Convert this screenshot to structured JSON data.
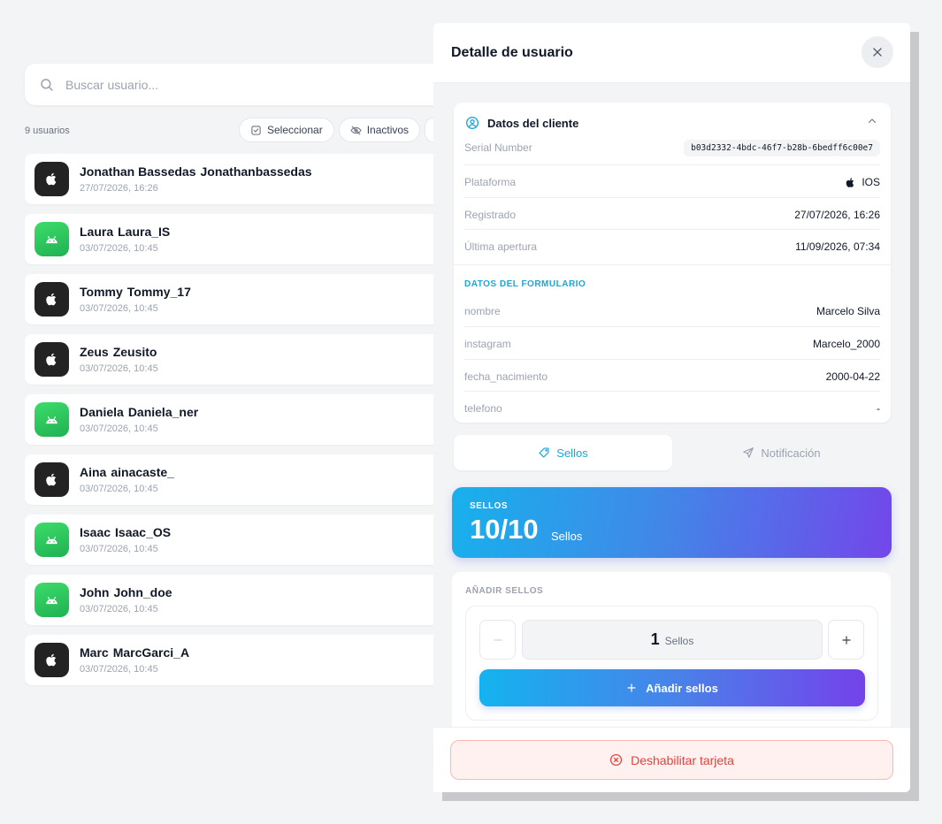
{
  "search": {
    "placeholder": "Buscar usuario..."
  },
  "list_header": {
    "count": "9 usuarios",
    "filters": [
      {
        "label": "Seleccionar",
        "icon": "checkbox-icon"
      },
      {
        "label": "Inactivos",
        "icon": "eye-off-icon"
      }
    ]
  },
  "users": [
    {
      "first": "Jonathan Bassedas",
      "handle": "Jonathanbassedas",
      "date": "27/07/2026, 16:26",
      "platform": "ios"
    },
    {
      "first": "Laura",
      "handle": "Laura_IS",
      "date": "03/07/2026, 10:45",
      "platform": "android"
    },
    {
      "first": "Tommy",
      "handle": "Tommy_17",
      "date": "03/07/2026, 10:45",
      "platform": "ios"
    },
    {
      "first": "Zeus",
      "handle": "Zeusito",
      "date": "03/07/2026, 10:45",
      "platform": "ios"
    },
    {
      "first": "Daniela",
      "handle": "Daniela_ner",
      "date": "03/07/2026, 10:45",
      "platform": "android"
    },
    {
      "first": "Aina",
      "handle": "ainacaste_",
      "date": "03/07/2026, 10:45",
      "platform": "ios"
    },
    {
      "first": "Isaac",
      "handle": "Isaac_OS",
      "date": "03/07/2026, 10:45",
      "platform": "android"
    },
    {
      "first": "John",
      "handle": "John_doe",
      "date": "03/07/2026, 10:45",
      "platform": "android"
    },
    {
      "first": "Marc",
      "handle": "MarcGarci_A",
      "date": "03/07/2026, 10:45",
      "platform": "ios"
    }
  ],
  "panel": {
    "title": "Detalle de usuario",
    "client_section": {
      "title": "Datos del cliente",
      "fields": {
        "serial": {
          "label": "Serial Number",
          "value": "b03d2332-4bdc-46f7-b28b-6bedff6c00e7"
        },
        "platform": {
          "label": "Plataforma",
          "value": "IOS"
        },
        "registered": {
          "label": "Registrado",
          "value": "27/07/2026, 16:26"
        },
        "last_open": {
          "label": "Última apertura",
          "value": "11/09/2026, 07:34"
        }
      },
      "form_label": "DATOS DEL FORMULARIO",
      "form": {
        "nombre": {
          "label": "nombre",
          "value": "Marcelo Silva"
        },
        "instagram": {
          "label": "instagram",
          "value": "Marcelo_2000"
        },
        "fecha": {
          "label": "fecha_nacimiento",
          "value": "2000-04-22"
        },
        "telefono": {
          "label": "telefono",
          "value": "-"
        }
      }
    },
    "tabs": {
      "stamps": "Sellos",
      "notification": "Notificación"
    },
    "stamps_card": {
      "label": "SELLOS",
      "value": "10/10",
      "unit": "Sellos"
    },
    "add_section": {
      "label": "AÑADIR SELLOS",
      "quantity": "1",
      "unit": "Sellos",
      "button": "Añadir sellos"
    },
    "footer": {
      "disable": "Deshabilitar tarjeta"
    }
  },
  "colors": {
    "accent": "#1ba7d6",
    "gradient_start": "#17b1ec",
    "gradient_end": "#7346ea",
    "danger": "#e2433c",
    "ios_bg": "#232323",
    "android_bg": "#26c05b"
  }
}
